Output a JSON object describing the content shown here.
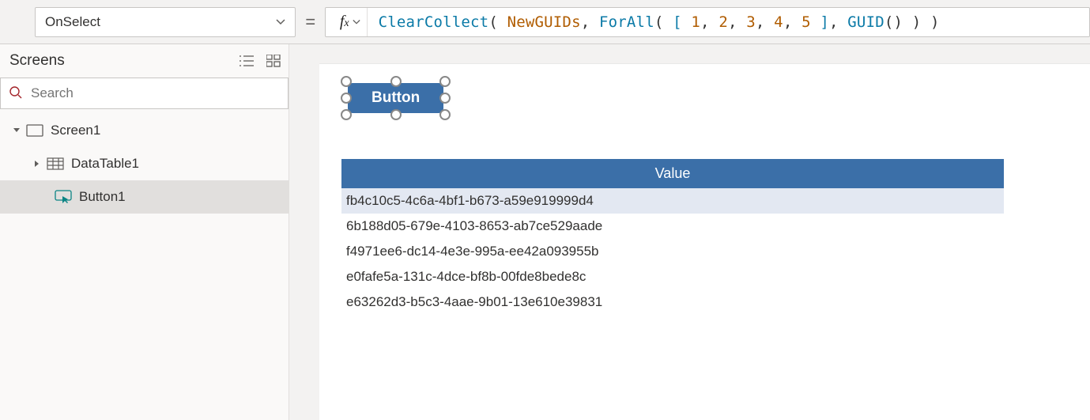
{
  "property_dropdown": {
    "value": "OnSelect"
  },
  "formula": {
    "tokens": [
      {
        "t": "func",
        "v": "ClearCollect"
      },
      {
        "t": "paren",
        "v": "( "
      },
      {
        "t": "ident",
        "v": "NewGUIDs"
      },
      {
        "t": "comma",
        "v": ", "
      },
      {
        "t": "func",
        "v": "ForAll"
      },
      {
        "t": "paren",
        "v": "( "
      },
      {
        "t": "squ",
        "v": "[ "
      },
      {
        "t": "num",
        "v": "1"
      },
      {
        "t": "comma",
        "v": ", "
      },
      {
        "t": "num",
        "v": "2"
      },
      {
        "t": "comma",
        "v": ", "
      },
      {
        "t": "num",
        "v": "3"
      },
      {
        "t": "comma",
        "v": ", "
      },
      {
        "t": "num",
        "v": "4"
      },
      {
        "t": "comma",
        "v": ", "
      },
      {
        "t": "num",
        "v": "5"
      },
      {
        "t": "squ",
        "v": " ]"
      },
      {
        "t": "comma",
        "v": ", "
      },
      {
        "t": "func",
        "v": "GUID"
      },
      {
        "t": "paren",
        "v": "() ) )"
      }
    ]
  },
  "screens_header": "Screens",
  "search_placeholder": "Search",
  "tree": {
    "screen": "Screen1",
    "datatable": "DataTable1",
    "button": "Button1"
  },
  "canvas": {
    "button_label": "Button",
    "table": {
      "header": "Value",
      "rows": [
        "fb4c10c5-4c6a-4bf1-b673-a59e919999d4",
        "6b188d05-679e-4103-8653-ab7ce529aade",
        "f4971ee6-dc14-4e3e-995a-ee42a093955b",
        "e0fafe5a-131c-4dce-bf8b-00fde8bede8c",
        "e63262d3-b5c3-4aae-9b01-13e610e39831"
      ]
    }
  }
}
